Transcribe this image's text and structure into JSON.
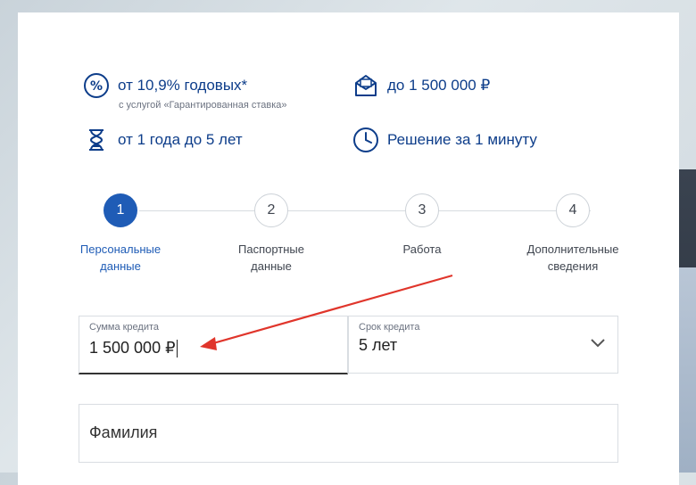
{
  "features": {
    "rate": {
      "text": "от 10,9% годовых*",
      "subtext": "с услугой «Гарантированная ставка»",
      "icon": "percent-icon"
    },
    "amount": {
      "text": "до 1 500 000 ₽",
      "icon": "wallet-icon"
    },
    "term": {
      "text": "от 1 года до 5 лет",
      "icon": "hourglass-icon"
    },
    "decision": {
      "text": "Решение за 1 минуту",
      "icon": "clock-icon"
    }
  },
  "steps": [
    {
      "number": "1",
      "label_line1": "Персональные",
      "label_line2": "данные",
      "active": true
    },
    {
      "number": "2",
      "label_line1": "Паспортные",
      "label_line2": "данные",
      "active": false
    },
    {
      "number": "3",
      "label_line1": "Работа",
      "label_line2": "",
      "active": false
    },
    {
      "number": "4",
      "label_line1": "Дополнительные",
      "label_line2": "сведения",
      "active": false
    }
  ],
  "form": {
    "amount_label": "Сумма кредита",
    "amount_value": "1 500 000 ₽",
    "term_label": "Срок кредита",
    "term_value": "5 лет",
    "surname_placeholder": "Фамилия"
  },
  "colors": {
    "brand": "#0d3d8a",
    "accent": "#1f5cb6",
    "annotation_arrow": "#e0352b"
  }
}
